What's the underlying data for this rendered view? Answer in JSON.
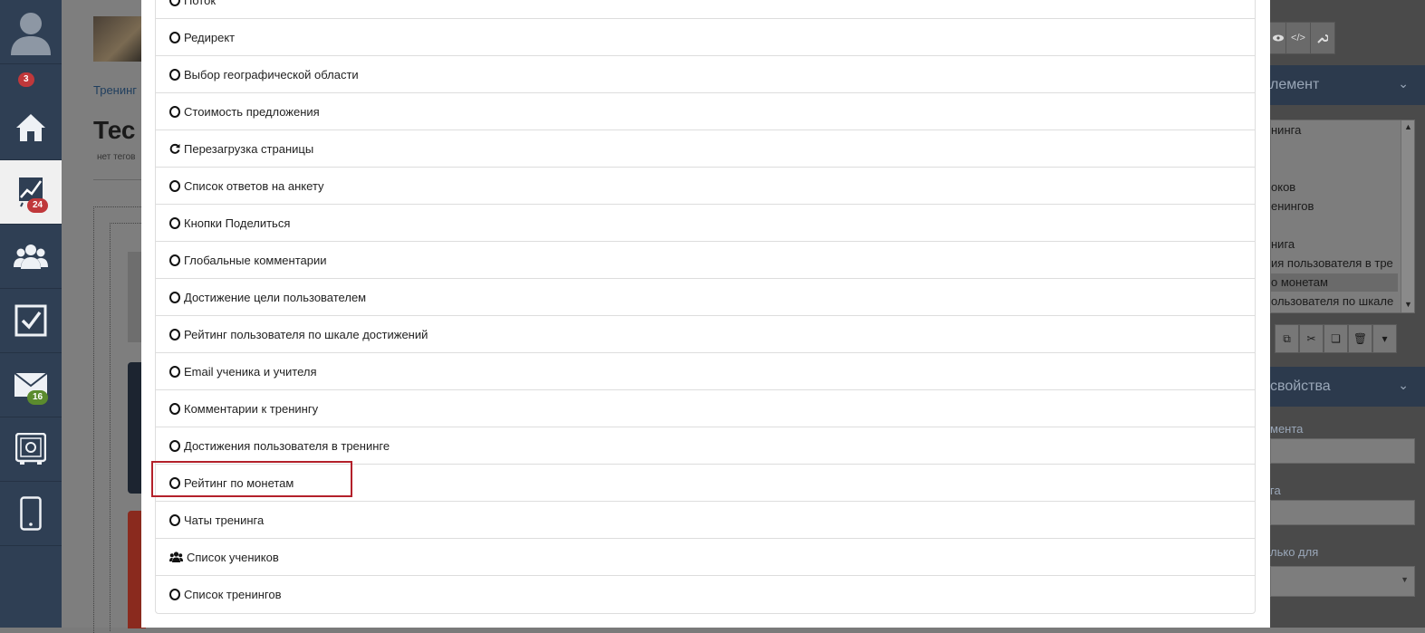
{
  "sidebar": {
    "badges": {
      "notifications": "3",
      "analytics": "24",
      "mail": "16"
    },
    "items": [
      {
        "icon": "user-avatar-icon"
      },
      {
        "icon": "home-icon"
      },
      {
        "icon": "analytics-chart-icon"
      },
      {
        "icon": "users-group-icon"
      },
      {
        "icon": "checkbox-tasks-icon"
      },
      {
        "icon": "mail-icon"
      },
      {
        "icon": "safe-vault-icon"
      },
      {
        "icon": "mobile-phone-icon"
      }
    ]
  },
  "background_page": {
    "breadcrumb": "Тренинг",
    "title": "Тес",
    "tags_text": "нет тегов"
  },
  "right_panel": {
    "toolbar_icons": [
      "eye-icon",
      "code-icon",
      "wrench-icon"
    ],
    "element_header": "лемент",
    "element_list": [
      {
        "label": "нинга",
        "selected": false
      },
      {
        "label": "",
        "selected": false
      },
      {
        "label": "",
        "selected": false
      },
      {
        "label": "оков",
        "selected": false
      },
      {
        "label": "енингов",
        "selected": false
      },
      {
        "label": "",
        "selected": false
      },
      {
        "label": "нига",
        "selected": false
      },
      {
        "label": "ия пользователя в тре",
        "selected": false
      },
      {
        "label": "о монетам",
        "selected": true
      },
      {
        "label": "ользователя по шкале",
        "selected": false
      }
    ],
    "element_actions": [
      "copy-icon",
      "cut-icon",
      "paste-icon",
      "trash-icon",
      "caret-down-icon"
    ],
    "properties_header": "свойства",
    "prop_labels": [
      "мента",
      "га",
      "лько для"
    ]
  },
  "modal": {
    "items": [
      {
        "label": "Поток",
        "icon": "circle-icon"
      },
      {
        "label": "Редирект",
        "icon": "circle-icon"
      },
      {
        "label": "Выбор географической области",
        "icon": "circle-icon"
      },
      {
        "label": "Стоимость предложения",
        "icon": "circle-icon"
      },
      {
        "label": "Перезагрузка страницы",
        "icon": "refresh-icon"
      },
      {
        "label": "Список ответов на анкету",
        "icon": "circle-icon"
      },
      {
        "label": "Кнопки Поделиться",
        "icon": "circle-icon"
      },
      {
        "label": "Глобальные комментарии",
        "icon": "circle-icon"
      },
      {
        "label": "Достижение цели пользователем",
        "icon": "circle-icon"
      },
      {
        "label": "Рейтинг пользователя по шкале достижений",
        "icon": "circle-icon"
      },
      {
        "label": "Email ученика и учителя",
        "icon": "circle-icon"
      },
      {
        "label": "Комментарии к тренингу",
        "icon": "circle-icon"
      },
      {
        "label": "Достижения пользователя в тренинге",
        "icon": "circle-icon"
      },
      {
        "label": "Рейтинг по монетам",
        "icon": "circle-icon",
        "highlighted": true
      },
      {
        "label": "Чаты тренинга",
        "icon": "circle-icon"
      },
      {
        "label": "Список учеников",
        "icon": "users-icon"
      },
      {
        "label": "Список тренингов",
        "icon": "circle-icon"
      }
    ]
  },
  "colors": {
    "sidebar_bg": "#2f3f54",
    "badge_red": "#c0383b",
    "badge_green": "#5b8b2e",
    "highlight_border": "#b3202a",
    "modal_bg": "#ffffff"
  }
}
